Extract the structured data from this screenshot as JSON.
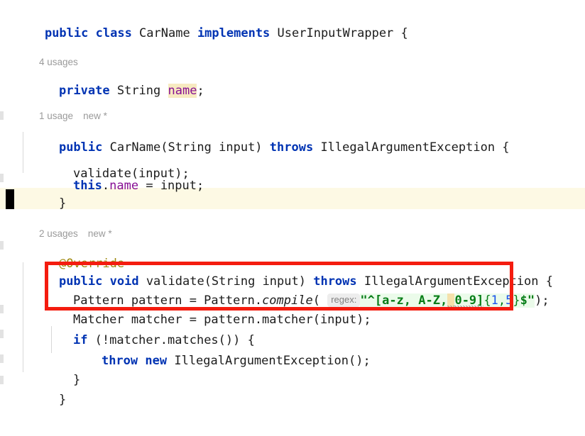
{
  "editor": {
    "language": "java",
    "background": "#ffffff",
    "caret_line_background": "#fdf9e4",
    "annotation_color": "#f41c0f"
  },
  "colors": {
    "keyword": "#0033b3",
    "field": "#871094",
    "annotation_tag": "#9e880d",
    "string": "#067d17",
    "string_background": "#ebfbea",
    "number": "#1750eb",
    "identifier_highlight": "#f7eac1",
    "selection": "#f5e1ab",
    "hint_text": "#808080",
    "hint_background": "#ededed",
    "gutter_tick": "#e2e2e2",
    "indent_guide": "#d8d8d8"
  },
  "code": {
    "line_1": {
      "tokens": [
        {
          "t": "public",
          "c": "kw"
        },
        {
          "t": " ",
          "c": "plain"
        },
        {
          "t": "class",
          "c": "kw"
        },
        {
          "t": " CarName ",
          "c": "plain"
        },
        {
          "t": "implements",
          "c": "kw"
        },
        {
          "t": " UserInputWrapper {",
          "c": "plain"
        }
      ],
      "text": "public class CarName implements UserInputWrapper {"
    },
    "line_2": {
      "tokens": [
        {
          "t": "private",
          "c": "kw"
        },
        {
          "t": " String ",
          "c": "plain"
        },
        {
          "t": "name",
          "c": "field-hl"
        },
        {
          "t": ";",
          "c": "plain"
        }
      ],
      "text": "private String name;"
    },
    "line_3": {
      "tokens": [
        {
          "t": "public",
          "c": "kw"
        },
        {
          "t": " CarName(String input) ",
          "c": "plain"
        },
        {
          "t": "throws",
          "c": "kw"
        },
        {
          "t": " IllegalArgumentException {",
          "c": "plain"
        }
      ],
      "text": "public CarName(String input) throws IllegalArgumentException {"
    },
    "line_4": {
      "tokens": [
        {
          "t": "validate(input);",
          "c": "plain"
        }
      ],
      "text": "validate(input);"
    },
    "line_5": {
      "tokens": [
        {
          "t": "this",
          "c": "kw"
        },
        {
          "t": ".",
          "c": "plain"
        },
        {
          "t": "name",
          "c": "field"
        },
        {
          "t": " = input;",
          "c": "plain"
        }
      ],
      "text": "this.name = input;"
    },
    "line_6": {
      "text": "}"
    },
    "line_7": {
      "tokens": [
        {
          "t": "@Override",
          "c": "anno"
        }
      ],
      "text": "@Override"
    },
    "line_8": {
      "tokens": [
        {
          "t": "public",
          "c": "kw"
        },
        {
          "t": " ",
          "c": "plain"
        },
        {
          "t": "void",
          "c": "kw"
        },
        {
          "t": " validate(String input) ",
          "c": "plain"
        },
        {
          "t": "throws",
          "c": "kw"
        },
        {
          "t": " IllegalArgumentException {",
          "c": "plain"
        }
      ],
      "text": "public void validate(String input) throws IllegalArgumentException {"
    },
    "line_9": {
      "prefix": "Pattern pattern = Pattern.",
      "method": "compile",
      "open_paren": "(",
      "hint": "regex:",
      "regex_quote_open": "\"",
      "regex_part_1": "^[a-z, A-Z,",
      "regex_selected_space": " ",
      "regex_part_2": "0-9]",
      "regex_brace_open": "{",
      "regex_min": "1",
      "regex_comma": ",",
      "regex_max": "5",
      "regex_brace_close": "}",
      "regex_anchor": "$",
      "regex_quote_close": "\"",
      "suffix": ");",
      "text": "Pattern pattern = Pattern.compile( regex: \"^[a-z, A-Z, 0-9]{1,5}$\");"
    },
    "line_10": {
      "tokens": [
        {
          "t": "Matcher matcher = pattern.matcher(input);",
          "c": "plain"
        }
      ],
      "text": "Matcher matcher = pattern.matcher(input);"
    },
    "line_11": {
      "tokens": [
        {
          "t": "if",
          "c": "kw"
        },
        {
          "t": " (!matcher.matches()) {",
          "c": "plain"
        }
      ],
      "text": "if (!matcher.matches()) {"
    },
    "line_12": {
      "tokens": [
        {
          "t": "throw",
          "c": "kw"
        },
        {
          "t": " ",
          "c": "plain"
        },
        {
          "t": "new",
          "c": "kw"
        },
        {
          "t": " IllegalArgumentException();",
          "c": "plain"
        }
      ],
      "text": "throw new IllegalArgumentException();"
    },
    "line_13": {
      "text": "}"
    },
    "line_14": {
      "text": "}"
    }
  },
  "inlay_hints": {
    "field_usages": "4 usages",
    "constructor_usages": "1 usage",
    "constructor_new": "new *",
    "validate_usages": "2 usages",
    "validate_new": "new *",
    "regex_param": "regex:"
  },
  "annotation": {
    "label": "highlight-rectangle",
    "target_lines": [
      "line_9",
      "line_10"
    ]
  }
}
